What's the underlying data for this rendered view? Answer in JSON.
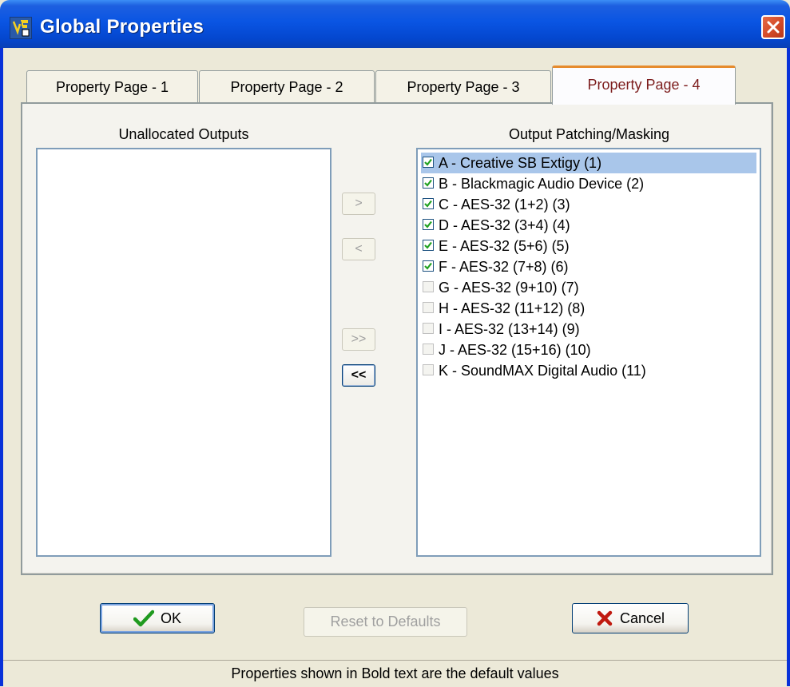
{
  "window": {
    "title": "Global Properties",
    "icon": "app-icon",
    "close_icon": "close-icon"
  },
  "tabs": [
    {
      "label": "Property Page - 1",
      "active": false
    },
    {
      "label": "Property Page - 2",
      "active": false
    },
    {
      "label": "Property Page - 3",
      "active": false
    },
    {
      "label": "Property Page - 4",
      "active": true
    }
  ],
  "unallocated": {
    "label": "Unallocated Outputs",
    "items": []
  },
  "patching": {
    "label": "Output Patching/Masking",
    "items": [
      {
        "text": "A  - Creative SB Extigy (1)",
        "checked": true,
        "selected": true
      },
      {
        "text": "B  - Blackmagic Audio Device (2)",
        "checked": true,
        "selected": false
      },
      {
        "text": "C  - AES-32 (1+2) (3)",
        "checked": true,
        "selected": false
      },
      {
        "text": "D  - AES-32 (3+4) (4)",
        "checked": true,
        "selected": false
      },
      {
        "text": "E  - AES-32 (5+6) (5)",
        "checked": true,
        "selected": false
      },
      {
        "text": "F  - AES-32 (7+8) (6)",
        "checked": true,
        "selected": false
      },
      {
        "text": "G  - AES-32 (9+10) (7)",
        "checked": false,
        "selected": false
      },
      {
        "text": "H  - AES-32 (11+12) (8)",
        "checked": false,
        "selected": false
      },
      {
        "text": "I   - AES-32 (13+14) (9)",
        "checked": false,
        "selected": false
      },
      {
        "text": "J  - AES-32 (15+16) (10)",
        "checked": false,
        "selected": false
      },
      {
        "text": "K  - SoundMAX Digital Audio (11)",
        "checked": false,
        "selected": false
      }
    ]
  },
  "move_buttons": {
    "add_one": {
      "label": ">",
      "enabled": false
    },
    "remove_one": {
      "label": "<",
      "enabled": false
    },
    "add_all": {
      "label": ">>",
      "enabled": false
    },
    "remove_all": {
      "label": "<<",
      "enabled": true
    }
  },
  "buttons": {
    "ok": {
      "label": "OK",
      "icon": "checkmark-icon"
    },
    "reset": {
      "label": "Reset to Defaults",
      "enabled": false
    },
    "cancel": {
      "label": "Cancel",
      "icon": "x-icon"
    }
  },
  "status": {
    "text": "Properties shown in Bold text are the default values"
  },
  "colors": {
    "title_bar": "#0a55e3",
    "active_tab_text": "#7c1c1c",
    "selection": "#a9c6ea",
    "check": "#21a121",
    "cancel_x": "#c01a10"
  }
}
